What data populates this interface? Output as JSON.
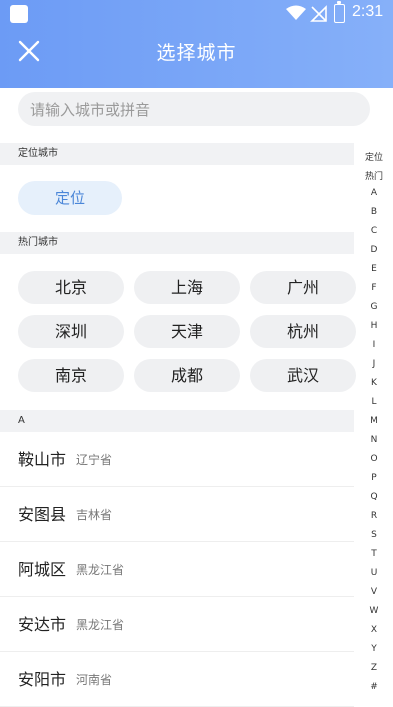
{
  "status_bar": {
    "time": "2:31"
  },
  "header": {
    "title": "选择城市"
  },
  "search": {
    "placeholder": "请输入城市或拼音"
  },
  "sections": {
    "locate": "定位城市",
    "hot": "热门城市",
    "letter_a": "A"
  },
  "locate_button": "定位",
  "hot_cities": [
    "北京",
    "上海",
    "广州",
    "深圳",
    "天津",
    "杭州",
    "南京",
    "成都",
    "武汉"
  ],
  "cities": [
    {
      "name": "鞍山市",
      "province": "辽宁省"
    },
    {
      "name": "安图县",
      "province": "吉林省"
    },
    {
      "name": "阿城区",
      "province": "黑龙江省"
    },
    {
      "name": "安达市",
      "province": "黑龙江省"
    },
    {
      "name": "安阳市",
      "province": "河南省"
    }
  ],
  "index_bar": [
    "定位",
    "热门",
    "A",
    "B",
    "C",
    "D",
    "E",
    "F",
    "G",
    "H",
    "I",
    "J",
    "K",
    "L",
    "M",
    "N",
    "O",
    "P",
    "Q",
    "R",
    "S",
    "T",
    "U",
    "V",
    "W",
    "X",
    "Y",
    "Z",
    "#"
  ],
  "colors": {
    "header_start": "#6c9bf5",
    "header_end": "#86b0f9",
    "accent": "#4a86d8"
  },
  "icons": {
    "close": "close-icon",
    "wifi": "wifi-icon",
    "signal": "no-signal-icon",
    "battery": "battery-charging-icon"
  }
}
